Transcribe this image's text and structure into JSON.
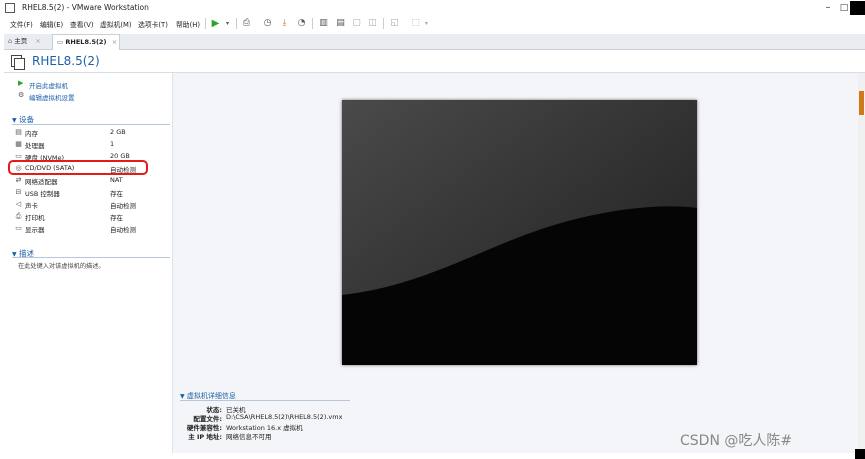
{
  "window": {
    "title": "RHEL8.5(2) - VMware Workstation",
    "minimize": "–",
    "maximize": "□"
  },
  "menu": [
    "文件(F)",
    "编辑(E)",
    "查看(V)",
    "虚拟机(M)",
    "选项卡(T)",
    "帮助(H)"
  ],
  "tabs": {
    "home": "主页",
    "vm": "RHEL8.5(2)"
  },
  "vm": {
    "title": "RHEL8.5(2)"
  },
  "actions": {
    "power_on": "开启此虚拟机",
    "edit_settings": "编辑虚拟机设置"
  },
  "devices": {
    "header": "设备",
    "items": [
      {
        "name": "内存",
        "value": "2 GB",
        "icon": "memory-icon"
      },
      {
        "name": "处理器",
        "value": "1",
        "icon": "cpu-icon"
      },
      {
        "name": "硬盘 (NVMe)",
        "value": "20 GB",
        "icon": "disk-icon"
      },
      {
        "name": "CD/DVD (SATA)",
        "value": "自动检测",
        "icon": "cd-icon"
      },
      {
        "name": "网络适配器",
        "value": "NAT",
        "icon": "network-icon"
      },
      {
        "name": "USB 控制器",
        "value": "存在",
        "icon": "usb-icon"
      },
      {
        "name": "声卡",
        "value": "自动检测",
        "icon": "sound-icon"
      },
      {
        "name": "打印机",
        "value": "存在",
        "icon": "printer-icon"
      },
      {
        "name": "显示器",
        "value": "自动检测",
        "icon": "display-icon"
      }
    ]
  },
  "description": {
    "header": "描述",
    "placeholder": "在此处键入对该虚拟机的描述。"
  },
  "details": {
    "header": "虚拟机详细信息",
    "rows": [
      {
        "label": "状态:",
        "value": "已关机"
      },
      {
        "label": "配置文件:",
        "value": "D:\\CSA\\RHEL8.5(2)\\RHEL8.5(2).vmx"
      },
      {
        "label": "硬件兼容性:",
        "value": "Workstation 16.x 虚拟机"
      },
      {
        "label": "主 IP 地址:",
        "value": "网络信息不可用"
      }
    ]
  },
  "watermark": "CSDN @吃人陈#",
  "colors": {
    "accent": "#1e5fa8",
    "highlight": "#e31b1b",
    "play": "#2aa52a"
  }
}
